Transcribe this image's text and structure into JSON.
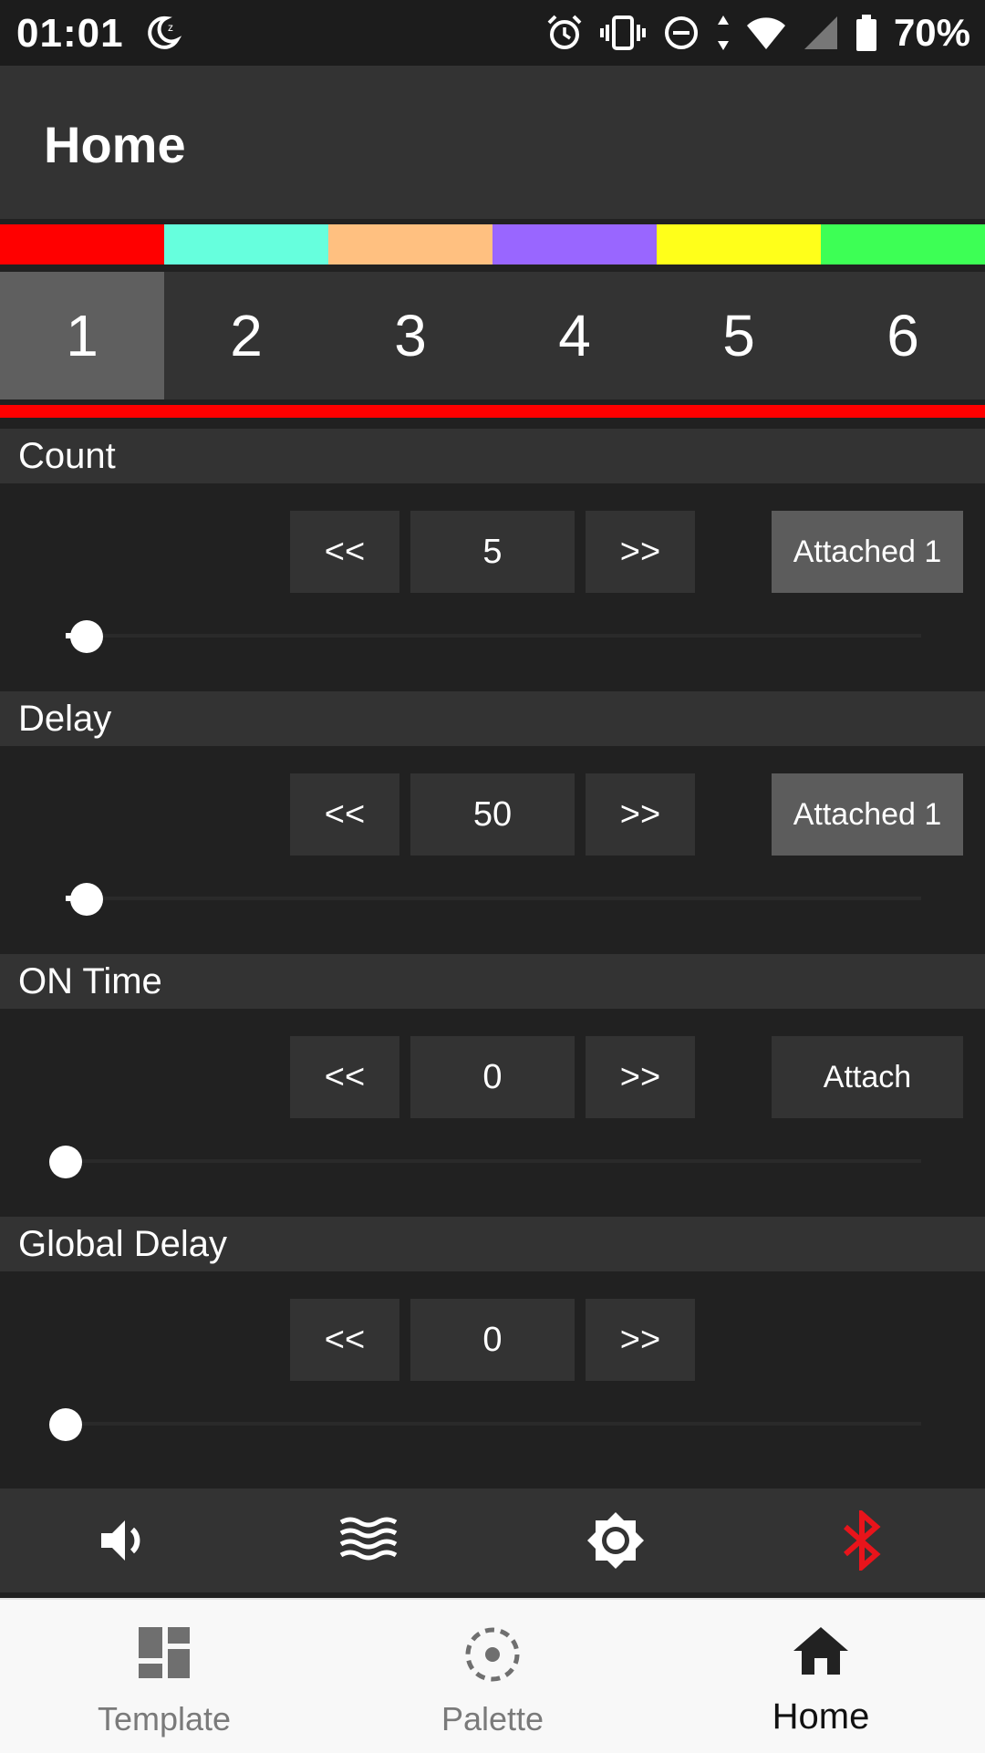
{
  "status_bar": {
    "time": "01:01",
    "battery": "70%"
  },
  "app_bar": {
    "title": "Home"
  },
  "color_swatches": [
    "#ff0000",
    "#66ffdd",
    "#ffc080",
    "#9966ff",
    "#ffff1a",
    "#3dff55"
  ],
  "tabs": [
    {
      "label": "1",
      "active": true
    },
    {
      "label": "2",
      "active": false
    },
    {
      "label": "3",
      "active": false
    },
    {
      "label": "4",
      "active": false
    },
    {
      "label": "5",
      "active": false
    },
    {
      "label": "6",
      "active": false
    }
  ],
  "active_color": "#ff0000",
  "controls": [
    {
      "label": "Count",
      "prev_label": "<<",
      "value": "5",
      "next_label": ">>",
      "attach_label": "Attached 1",
      "attached": true,
      "slider_fraction": 0.025
    },
    {
      "label": "Delay",
      "prev_label": "<<",
      "value": "50",
      "next_label": ">>",
      "attach_label": "Attached 1",
      "attached": true,
      "slider_fraction": 0.025
    },
    {
      "label": "ON Time",
      "prev_label": "<<",
      "value": "0",
      "next_label": ">>",
      "attach_label": "Attach",
      "attached": false,
      "slider_fraction": 0.0
    },
    {
      "label": "Global Delay",
      "prev_label": "<<",
      "value": "0",
      "next_label": ">>",
      "attach_label": null,
      "attached": false,
      "slider_fraction": 0.0
    }
  ],
  "toolbar": {
    "icons": [
      "volume-icon",
      "waves-icon",
      "brightness-icon",
      "bluetooth-icon"
    ],
    "bluetooth_color": "#e8141b"
  },
  "bottom_nav": {
    "items": [
      {
        "label": "Template",
        "icon": "dashboard-icon",
        "active": false
      },
      {
        "label": "Palette",
        "icon": "palette-icon",
        "active": false
      },
      {
        "label": "Home",
        "icon": "home-icon",
        "active": true
      }
    ]
  }
}
